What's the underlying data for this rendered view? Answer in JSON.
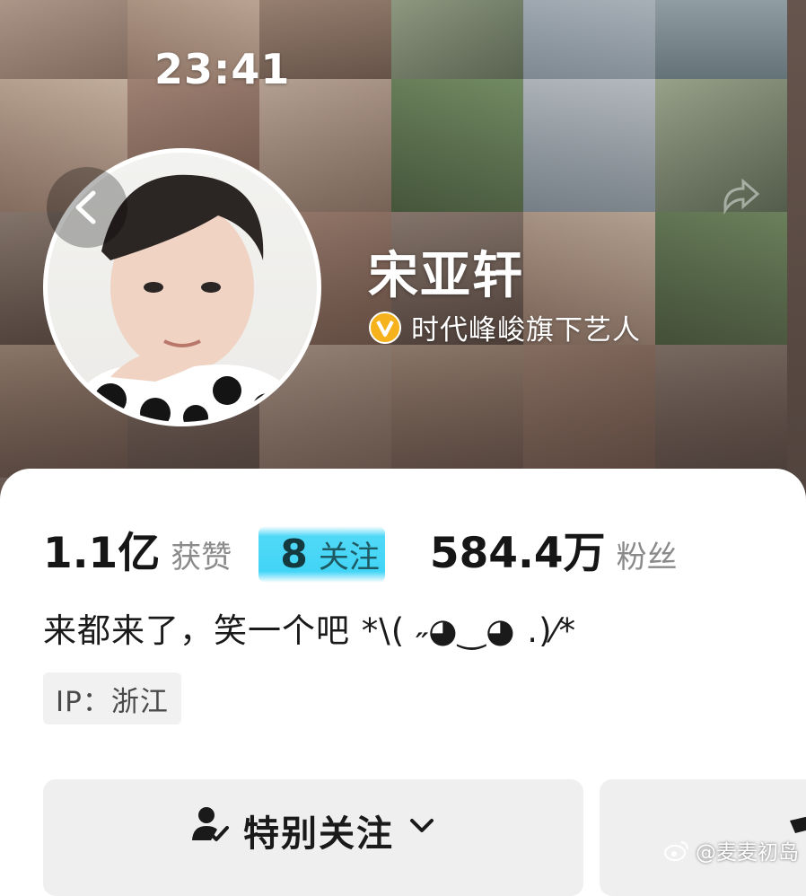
{
  "status_bar": {
    "time": "23:41"
  },
  "profile": {
    "nickname": "宋亚轩",
    "verified_text": "时代峰峻旗下艺人",
    "verified_badge_color": "#f5b21c"
  },
  "stats": [
    {
      "value": "1.1亿",
      "label": "获赞"
    },
    {
      "value": "8",
      "label": "关注"
    },
    {
      "value": "584.4万",
      "label": "粉丝"
    }
  ],
  "highlight_color": "#20cdf5",
  "bio": "来都来了，笑一个吧 *\\( ˶◕‿◕ .)⁄*",
  "ip_location": "IP：浙江",
  "actions": {
    "special_follow_label": "特别关注"
  },
  "watermark": {
    "text": "@麦麦初岛"
  },
  "icons": [
    "back-icon",
    "user-check-icon",
    "chevron-down-icon",
    "share-icon",
    "weibo-icon"
  ]
}
